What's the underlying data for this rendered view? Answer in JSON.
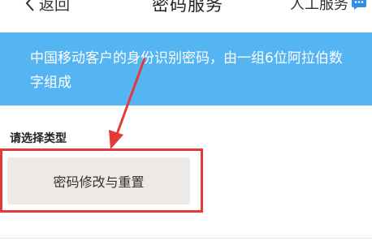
{
  "navbar": {
    "back_label": "返回",
    "title": "密码服务",
    "service_label": "人工服务"
  },
  "banner": {
    "text": "中国移动客户的身份识别密码，由一组6位阿拉伯数字组成"
  },
  "section": {
    "label": "请选择类型"
  },
  "options": [
    {
      "label": "密码修改与重置"
    }
  ],
  "colors": {
    "banner_bg": "#55b4f2",
    "highlight": "#e53a3a",
    "option_bg": "#ece9e7",
    "chat_icon": "#2f8ee8"
  }
}
